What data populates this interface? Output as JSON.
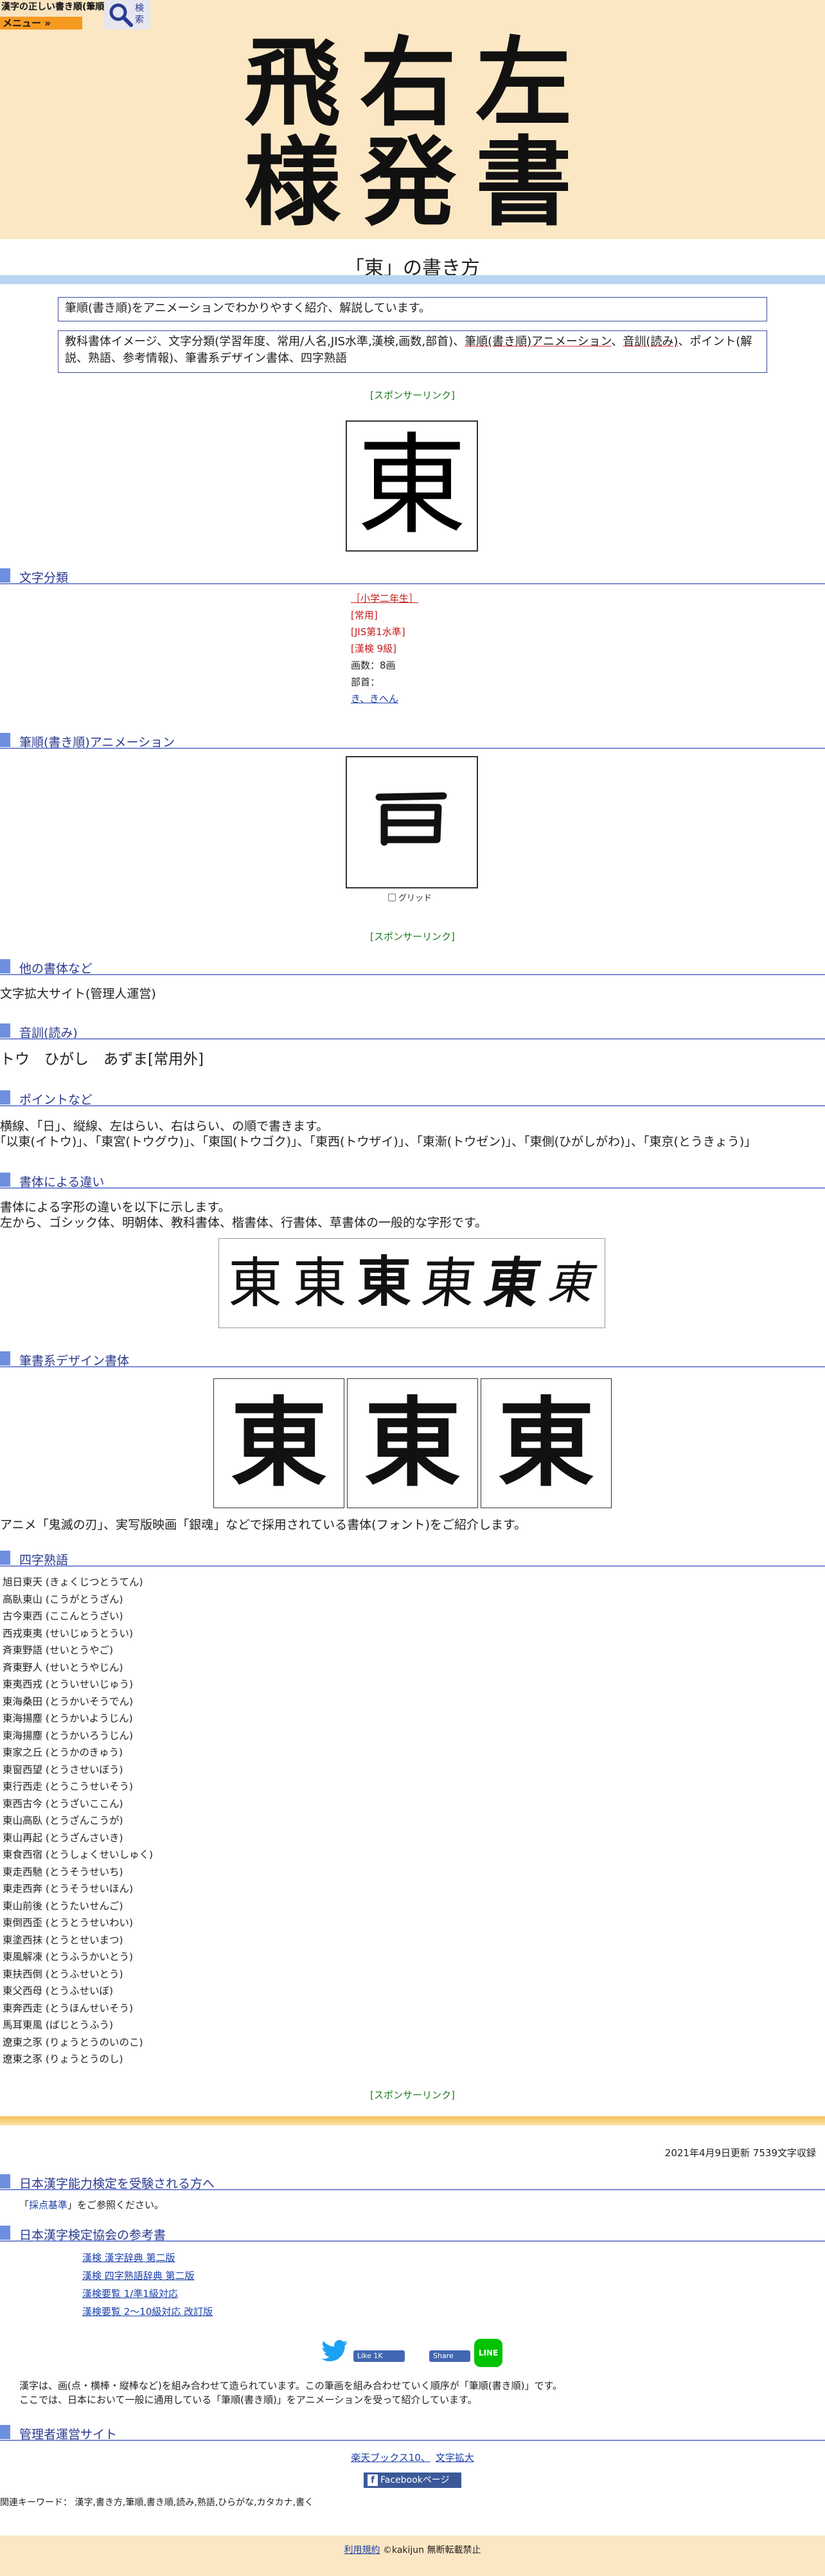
{
  "header": {
    "site_mini_title": "漢字の正しい書き順(筆順)",
    "menu_label": "メニュー »",
    "search_label": "検索",
    "banner_title": "飛右左様発書"
  },
  "page_title": "「東」の書き方",
  "intro": {
    "line1": "筆順(書き順)をアニメーションでわかりやすく紹介、解説しています。",
    "line2_pre": "教科書体イメージ、文字分類(学習年度、常用/人名,JIS水準,漢検,画数,部首)、",
    "line2_link1": "筆順(書き順)アニメーション",
    "line2_sep": "、",
    "line2_link2": "音訓(読み)",
    "line2_post": "、ポイント(解説、熟語、参考情報)、筆書系デザイン書体、四字熟語"
  },
  "sponsor_label": "[スポンサーリンク]",
  "kanji": "東",
  "sections": {
    "classification": "文字分類",
    "animation": "筆順(書き順)アニメーション",
    "other_fonts": "他の書体など",
    "reading": "音訓(読み)",
    "points": "ポイントなど",
    "by_font": "書体による違い",
    "brush_design": "筆書系デザイン書体",
    "yoji": "四字熟語",
    "kentei_takers": "日本漢字能力検定を受験される方へ",
    "kentei_refs": "日本漢字検定協会の参考書",
    "admin_sites": "管理者運営サイト"
  },
  "classification": {
    "grade": "［小学二年生］",
    "common": "[常用]",
    "jis": "[JIS第1水準]",
    "kanken": "[漢検 9級]",
    "strokes": "画数：8画",
    "radical_label": "部首：",
    "radical_link": "き、きへん"
  },
  "grid_label": "グリッド",
  "other_fonts_link": "文字拡大サイト(管理人運営)",
  "reading_text": "トウ　ひがし　あずま[常用外]",
  "points": {
    "line1": "横線、｢日｣、縦線、左はらい、右はらい、の順で書きます。",
    "line2": "｢以東(イトウ)｣、｢東宮(トウグウ)｣、｢東国(トウゴク)｣、｢東西(トウザイ)｣、｢東漸(トウゼン)｣、｢東側(ひがしがわ)｣、｢東京(とうきょう)｣"
  },
  "by_font": {
    "line1": "書体による字形の違いを以下に示します。",
    "line2": "左から、ゴシック体、明朝体、教科書体、楷書体、行書体、草書体の一般的な字形です。"
  },
  "brush_note": "アニメ「鬼滅の刃」、実写版映画「銀魂」などで採用されている書体(フォント)をご紹介します。",
  "yoji": [
    "旭日東天 (きょくじつとうてん)",
    "高臥東山 (こうがとうざん)",
    "古今東西 (ここんとうざい)",
    "西戎東夷 (せいじゅうとうい)",
    "斉東野語 (せいとうやご)",
    "斉東野人 (せいとうやじん)",
    "東夷西戎 (とういせいじゅう)",
    "東海桑田 (とうかいそうでん)",
    "東海揚塵 (とうかいようじん)",
    "東海揚塵 (とうかいろうじん)",
    "東家之丘 (とうかのきゅう)",
    "東窗西望 (とうさせいぼう)",
    "東行西走 (とうこうせいそう)",
    "東西古今 (とうざいここん)",
    "東山高臥 (とうざんこうが)",
    "東山再起 (とうざんさいき)",
    "東食西宿 (とうしょくせいしゅく)",
    "東走西馳 (とうそうせいち)",
    "東走西奔 (とうそうせいほん)",
    "東山前後 (とうたいせんご)",
    "東倒西歪 (とうとうせいわい)",
    "東塗西抹 (とうとせいまつ)",
    "東風解凍 (とうふうかいとう)",
    "東扶西倒 (とうふせいとう)",
    "東父西母 (とうふせいぼ)",
    "東奔西走 (とうほんせいそう)",
    "馬耳東風 (ばじとうふう)",
    "遼東之豕 (りょうとうのいのこ)",
    "遼東之豕 (りょうとうのし)"
  ],
  "update_text": "2021年4月9日更新 7539文字収録",
  "kentei_text_pre": "「",
  "kentei_link": "採点基準",
  "kentei_text_post": "」をご参照ください。",
  "kentei_books": [
    "漢検 漢字辞典 第二版",
    "漢検 四字熟語辞典 第二版",
    "漢検要覧 1/準1級対応",
    "漢検要覧 2～10級対応 改訂版"
  ],
  "share": {
    "fb_like": "Like 1K",
    "fb_share": "Share",
    "line": "LINE"
  },
  "explain": {
    "line1": "漢字は、画(点・横棒・縦棒など)を組み合わせて造られています。この筆画を組み合わせていく順序が「筆順(書き順)」です。",
    "line2": "ここでは、日本において一般に通用している「筆順(書き順)」をアニメーションを受って紹介しています。"
  },
  "admin_links": [
    "楽天ブックス10、",
    "文字拡大"
  ],
  "fb_page_label": "Facebookページ",
  "keywords": "関連キーワード： 漢字,書き方,筆順,書き順,読み,熟語,ひらがな,カタカナ,書く",
  "footer": {
    "terms_link": "利用規約",
    "copyright": "©kakijun 無断転載禁止"
  }
}
